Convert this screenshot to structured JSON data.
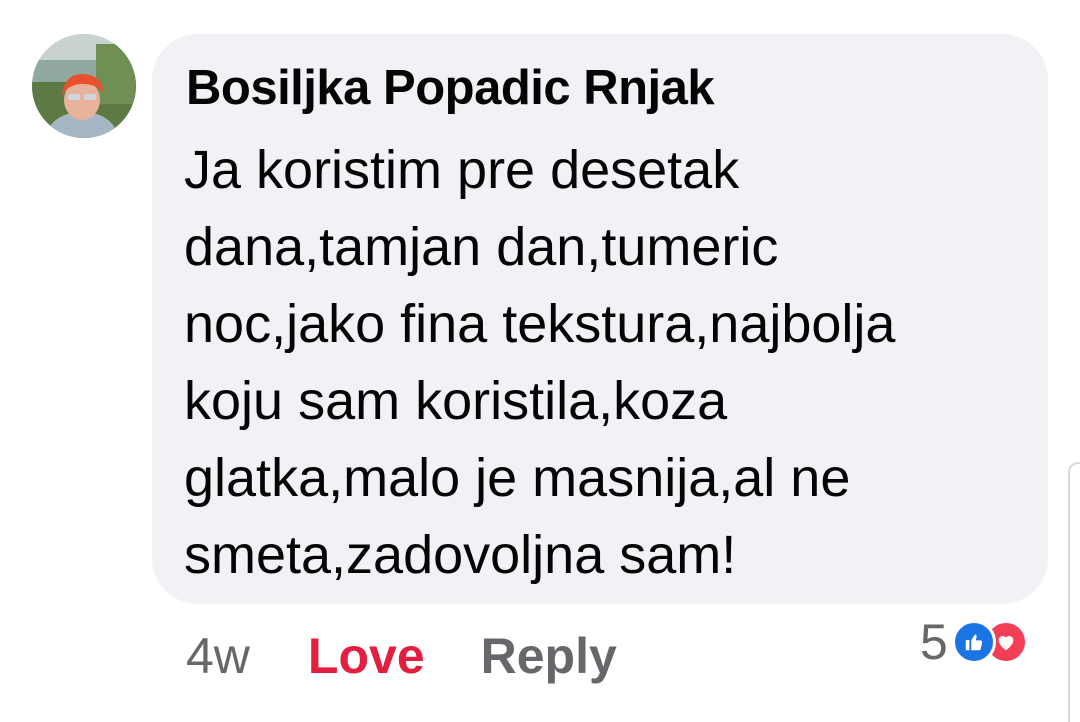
{
  "comment": {
    "author": "Bosiljka Popadic Rnjak",
    "text_lines": [
      "Ja koristim pre desetak",
      "dana,tamjan dan,tumeric",
      "noc,jako fina tekstura,najbolja",
      "koju sam koristila,koza",
      "glatka,malo je masnija,al ne",
      "smeta,zadovoljna sam!"
    ],
    "avatar_icon": "profile-photo"
  },
  "actions": {
    "time": "4w",
    "love_label": "Love",
    "reply_label": "Reply"
  },
  "reactions": {
    "count": "5",
    "icons": [
      "like-icon",
      "heart-icon"
    ],
    "colors": {
      "like": "#1b74e4",
      "heart": "#f33e58"
    }
  },
  "colors": {
    "bubble": "#f0f2f5",
    "love_active": "#e41e3f",
    "secondary_text": "#65676b"
  }
}
